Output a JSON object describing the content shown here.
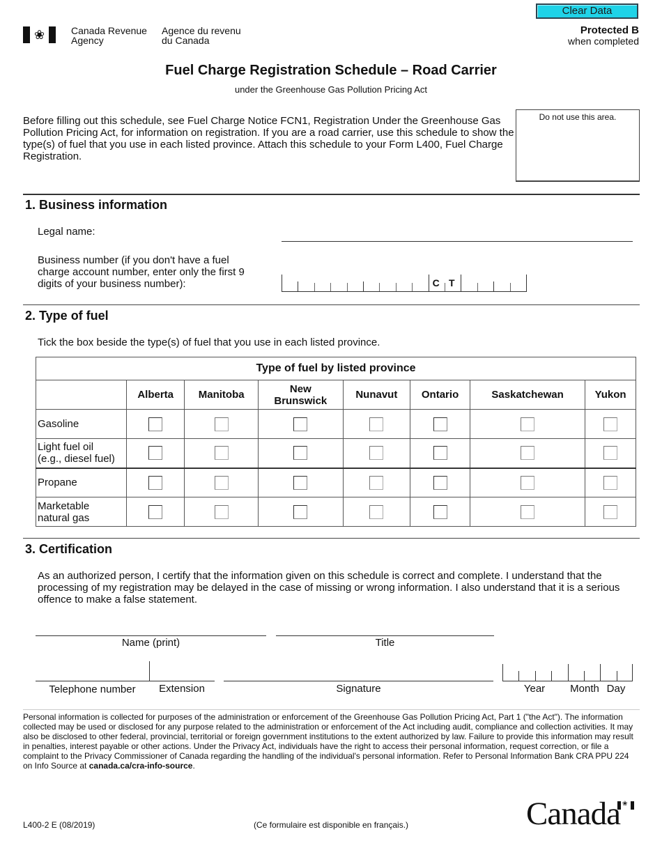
{
  "header": {
    "flag_icon": "canada-flag-icon",
    "agency_en": [
      "Canada Revenue",
      "Agency"
    ],
    "agency_fr": [
      "Agence du revenu",
      "du Canada"
    ],
    "clear_button": "Clear Data",
    "protected": "Protected B",
    "protected_note": "when completed"
  },
  "title": "Fuel Charge Registration Schedule – Road Carrier",
  "subtitle": "under the Greenhouse Gas Pollution Pricing Act",
  "intro": "Before filling out this schedule, see Fuel Charge Notice FCN1, Registration Under the Greenhouse Gas Pollution Pricing Act, for information on registration. If you are a road carrier, use this schedule to show the type(s) of fuel that you use in each listed province. Attach this schedule to your Form L400, Fuel Charge Registration.",
  "do_not_use": "Do not use this area.",
  "section1": {
    "heading": "1. Business information",
    "legal_name_label": "Legal name:",
    "legal_name_value": "",
    "bn_label": "Business number (if you don't have a fuel charge account number, enter only the first 9 digits of your business number):",
    "bn_prefix_letters": [
      "C",
      "T"
    ],
    "bn_value": ""
  },
  "section2": {
    "heading": "2. Type of fuel",
    "instruction": "Tick the box beside the type(s) of fuel that you use in each listed province.",
    "table_caption": "Type of fuel by listed province",
    "provinces": [
      "Alberta",
      "Manitoba",
      "New Brunswick",
      "Nunavut",
      "Ontario",
      "Saskatchewan",
      "Yukon"
    ],
    "fuels": [
      {
        "label": "Gasoline",
        "checked": [
          false,
          false,
          false,
          false,
          false,
          false,
          false
        ]
      },
      {
        "label": "Light fuel oil (e.g., diesel fuel)",
        "checked": [
          false,
          false,
          false,
          false,
          false,
          false,
          false
        ]
      },
      {
        "label": "Propane",
        "checked": [
          false,
          false,
          false,
          false,
          false,
          false,
          false
        ]
      },
      {
        "label": "Marketable natural gas",
        "checked": [
          false,
          false,
          false,
          false,
          false,
          false,
          false
        ]
      }
    ]
  },
  "section3": {
    "heading": "3. Certification",
    "statement": "As an authorized person, I certify that the information given on this schedule is correct and complete. I understand that the processing of my registration may be delayed in the case of missing or wrong information. I also understand that it is a serious offence to make a false statement.",
    "name_label": "Name (print)",
    "title_label": "Title",
    "telephone_label": "Telephone number",
    "extension_label": "Extension",
    "signature_label": "Signature",
    "year_label": "Year",
    "month_label": "Month",
    "day_label": "Day"
  },
  "privacy": {
    "text": "Personal information is collected for purposes of the administration or enforcement of the Greenhouse Gas Pollution Pricing Act, Part 1 (\"the Act\"). The information collected may be used or disclosed for any purpose related to the administration or enforcement of the Act including audit, compliance and collection activities. It may also be disclosed to other federal, provincial, territorial or foreign government institutions to the extent authorized by law. Failure to provide this information may result in penalties, interest payable or other actions. Under the Privacy Act, individuals have the right to access their personal information, request correction, or file a complaint to the Privacy Commissioner of Canada regarding the handling of the individual's personal information. Refer to Personal Information Bank CRA PPU 224 on Info Source at ",
    "link": "canada.ca/cra-info-source",
    "end": "."
  },
  "footer": {
    "form_number": "L400-2 E (08/2019)",
    "french_note": "(Ce formulaire est disponible en français.)",
    "wordmark": "Canada"
  },
  "colors": {
    "clear_button_bg": "#1fd3e8",
    "clear_button_border": "#2b4450"
  }
}
